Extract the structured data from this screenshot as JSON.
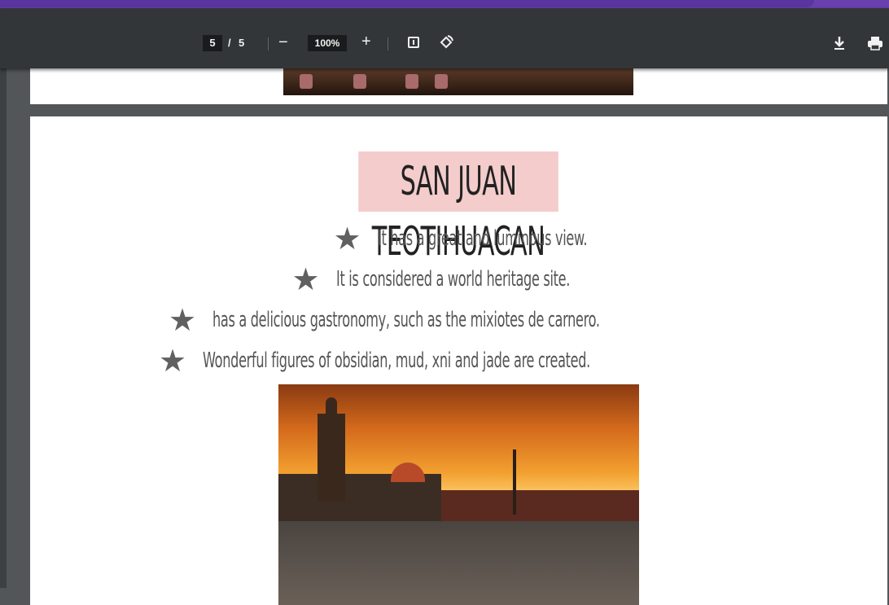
{
  "toolbar": {
    "current_page": "5",
    "page_separator": "/",
    "total_pages": "5",
    "zoom_out_label": "−",
    "zoom_level": "100%",
    "zoom_in_label": "+",
    "icons": [
      "fit-to-page-icon",
      "rotate-icon",
      "download-icon",
      "print-icon"
    ]
  },
  "document": {
    "title": "SAN JUAN TEOTIHUACAN",
    "title_highlight_color": "#f4cccc",
    "bullets": [
      "It has a great and luminous view.",
      "It is considered a world heritage site.",
      "has a delicious gastronomy, such as the mixiotes de carnero.",
      "Wonderful figures of obsidian, mud, xni and jade are created."
    ],
    "bullet_glyph": "★"
  },
  "colors": {
    "toolbar_bg": "#323639",
    "viewer_bg": "#525659",
    "tab_strip": "#6a3fb0"
  }
}
